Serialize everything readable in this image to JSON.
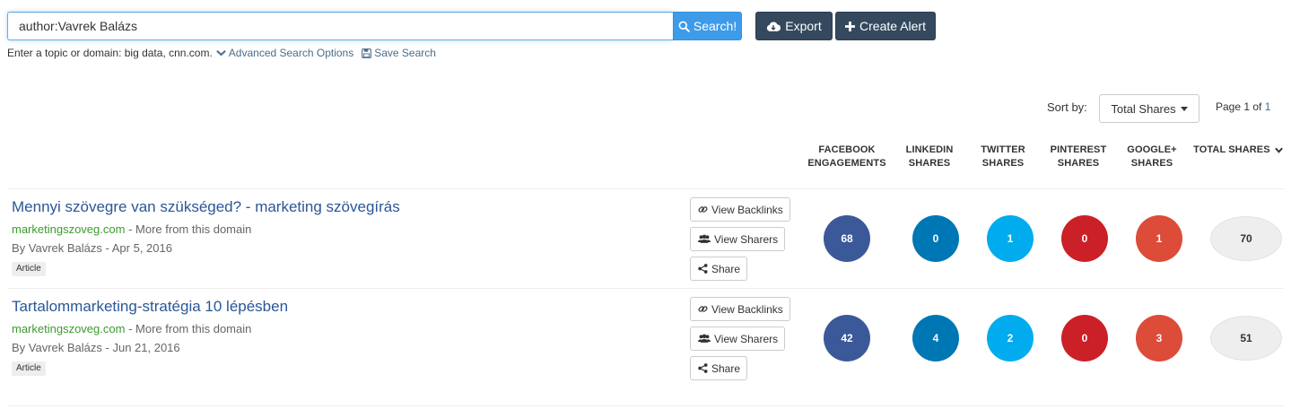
{
  "search": {
    "value": "author:Vavrek Balázs",
    "button_label": "Search!",
    "search_icon": "search-icon"
  },
  "toolbar": {
    "export_label": "Export",
    "export_icon": "cloud-download-icon",
    "create_alert_label": "Create Alert",
    "create_alert_icon": "plus-icon"
  },
  "hints": {
    "text": "Enter a topic or domain: big data, cnn.com.",
    "advanced_label": "Advanced Search Options",
    "save_label": "Save Search"
  },
  "sort": {
    "label": "Sort by:",
    "selected": "Total Shares"
  },
  "pagination": {
    "page_word": "Page 1 of",
    "total_pages": "1"
  },
  "columns": {
    "facebook": [
      "FACEBOOK",
      "ENGAGEMENTS"
    ],
    "linkedin": [
      "LINKEDIN",
      "SHARES"
    ],
    "twitter": [
      "TWITTER",
      "SHARES"
    ],
    "pinterest": [
      "PINTEREST",
      "SHARES"
    ],
    "googleplus": [
      "GOOGLE+",
      "SHARES"
    ],
    "total": "TOTAL SHARES"
  },
  "colors": {
    "facebook": "#3b5998",
    "linkedin": "#0077b5",
    "twitter": "#00aced",
    "pinterest": "#cb2027",
    "googleplus": "#dd4b39",
    "title_link": "#2a5698",
    "domain_link": "#3b9b2d",
    "search_button": "#3d9be9",
    "dark_button": "#34495e"
  },
  "actions": {
    "backlinks": "View Backlinks",
    "sharers": "View Sharers",
    "share": "Share"
  },
  "articles": [
    {
      "title": "Mennyi szövegre van szükséged? - marketing szövegírás",
      "domain": "marketingszoveg.com",
      "more": "More from this domain",
      "byline": "By Vavrek Balázs - Apr 5, 2016",
      "tag": "Article",
      "facebook": "68",
      "linkedin": "0",
      "twitter": "1",
      "pinterest": "0",
      "googleplus": "1",
      "total": "70"
    },
    {
      "title": "Tartalommarketing-stratégia 10 lépésben",
      "domain": "marketingszoveg.com",
      "more": "More from this domain",
      "byline": "By Vavrek Balázs - Jun 21, 2016",
      "tag": "Article",
      "facebook": "42",
      "linkedin": "4",
      "twitter": "2",
      "pinterest": "0",
      "googleplus": "3",
      "total": "51"
    }
  ]
}
